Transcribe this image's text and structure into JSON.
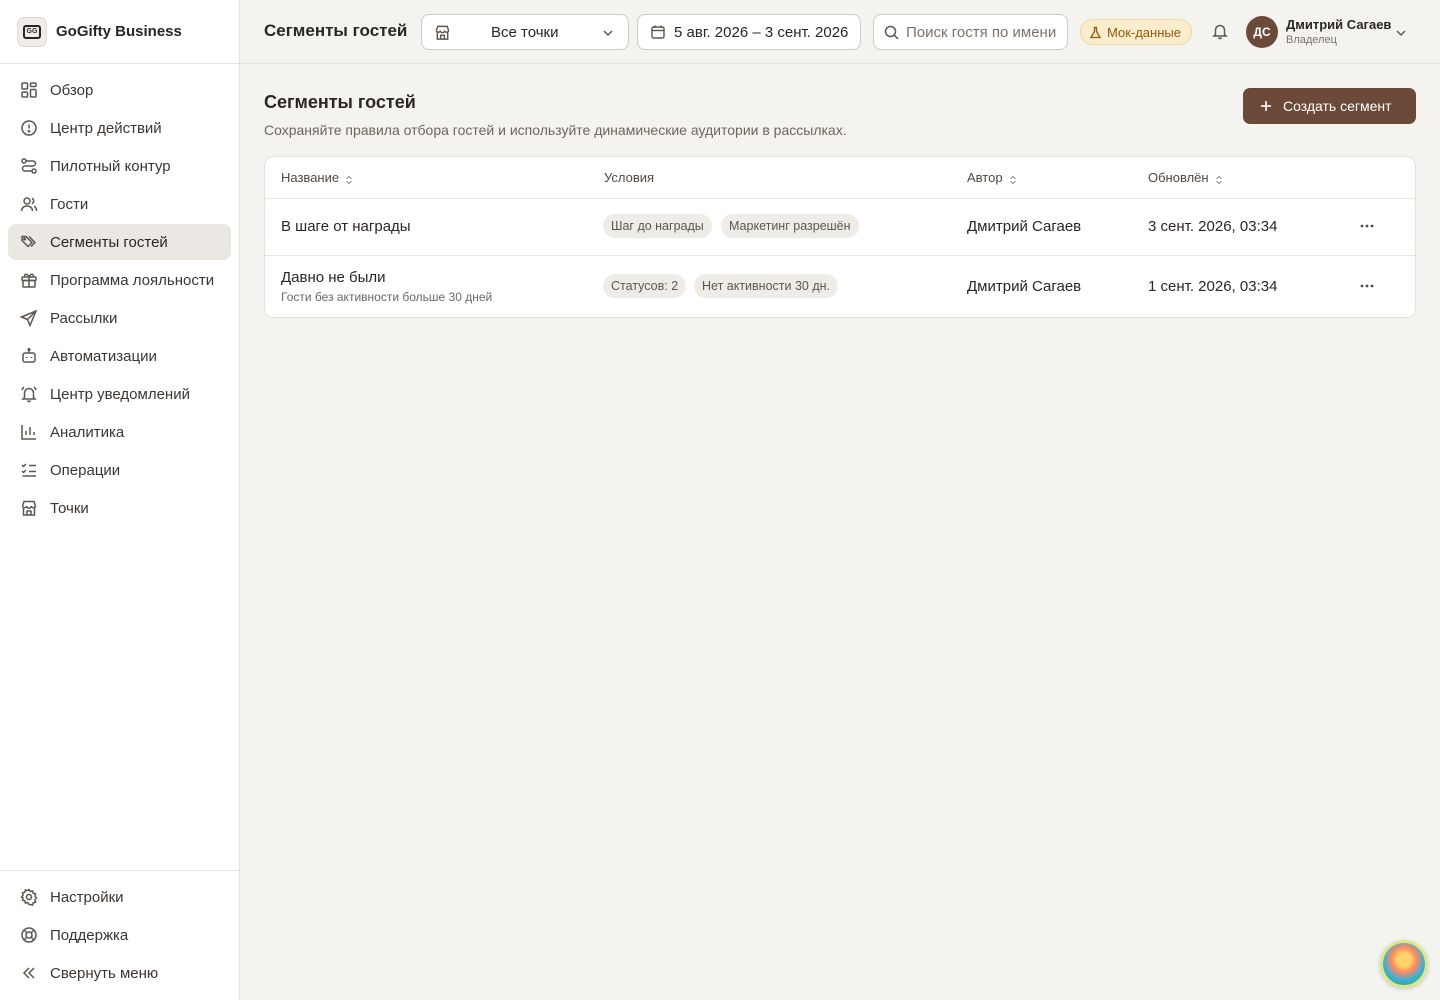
{
  "brand": {
    "logo_text": "GG",
    "name": "GoGifty Business"
  },
  "sidebar": {
    "items": [
      {
        "label": "Обзор",
        "icon": "grid-icon"
      },
      {
        "label": "Центр действий",
        "icon": "alert-circle-icon"
      },
      {
        "label": "Пилотный контур",
        "icon": "route-icon"
      },
      {
        "label": "Гости",
        "icon": "users-icon"
      },
      {
        "label": "Сегменты гостей",
        "icon": "tags-icon",
        "active": true
      },
      {
        "label": "Программа лояльности",
        "icon": "gift-icon"
      },
      {
        "label": "Рассылки",
        "icon": "send-icon"
      },
      {
        "label": "Автоматизации",
        "icon": "bot-icon"
      },
      {
        "label": "Центр уведомлений",
        "icon": "bell-ring-icon"
      },
      {
        "label": "Аналитика",
        "icon": "bar-chart-icon"
      },
      {
        "label": "Операции",
        "icon": "list-checks-icon"
      },
      {
        "label": "Точки",
        "icon": "store-icon"
      }
    ],
    "bottom": [
      {
        "label": "Настройки",
        "icon": "gear-icon"
      },
      {
        "label": "Поддержка",
        "icon": "lifebuoy-icon"
      },
      {
        "label": "Свернуть меню",
        "icon": "chevrons-left-icon"
      }
    ]
  },
  "topbar": {
    "title": "Сегменты гостей",
    "location_select": "Все точки",
    "date_range": "5 авг. 2026 – 3 сент. 2026",
    "search_placeholder": "Поиск гостя по имени",
    "mock_badge": "Мок-данные",
    "user": {
      "initials": "ДС",
      "name": "Дмитрий Сагаев",
      "role": "Владелец"
    }
  },
  "page": {
    "title": "Сегменты гостей",
    "subtitle": "Сохраняйте правила отбора гостей и используйте динамические аудитории в рассылках.",
    "create_button": "Создать сегмент"
  },
  "table": {
    "columns": {
      "name": "Название",
      "conditions": "Условия",
      "author": "Автор",
      "updated": "Обновлён"
    },
    "rows": [
      {
        "name": "В шаге от награды",
        "description": "",
        "conditions": [
          "Шаг до награды",
          "Маркетинг разрешён"
        ],
        "author": "Дмитрий Сагаев",
        "updated": "3 сент. 2026, 03:34"
      },
      {
        "name": "Давно не были",
        "description": "Гости без активности больше 30 дней",
        "conditions": [
          "Статусов: 2",
          "Нет активности 30 дн."
        ],
        "author": "Дмитрий Сагаев",
        "updated": "1 сент. 2026, 03:34"
      }
    ]
  },
  "colors": {
    "accent": "#6b4a3a",
    "background": "#f5f3ef",
    "mock_badge_bg": "#fbeccb",
    "mock_badge_text": "#8a5a13"
  }
}
